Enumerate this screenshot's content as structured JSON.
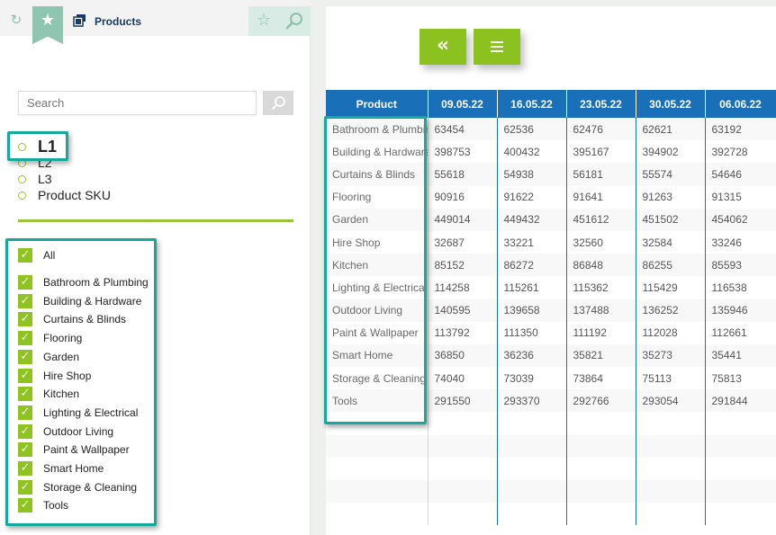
{
  "header": {
    "title": "Products",
    "refresh_icon": "refresh-icon",
    "bookmark_icon": "star-icon",
    "products_icon": "cube-icon",
    "star_icon": "star-outline-icon",
    "search_icon": "search-icon"
  },
  "search": {
    "placeholder": "Search"
  },
  "levels": [
    {
      "label": "L1",
      "active": true
    },
    {
      "label": "L2",
      "active": false
    },
    {
      "label": "L3",
      "active": false
    },
    {
      "label": "Product SKU",
      "active": false
    }
  ],
  "filters": {
    "all_label": "All",
    "items": [
      "Bathroom & Plumbing",
      "Building & Hardware",
      "Curtains & Blinds",
      "Flooring",
      "Garden",
      "Hire Shop",
      "Kitchen",
      "Lighting & Electrical",
      "Outdoor Living",
      "Paint & Wallpaper",
      "Smart Home",
      "Storage & Cleaning",
      "Tools"
    ]
  },
  "toolbar": {
    "collapse_label": "«",
    "menu_icon": "menu-icon"
  },
  "table": {
    "columns": [
      "Product",
      "09.05.22",
      "16.05.22",
      "23.05.22",
      "30.05.22",
      "06.06.22"
    ],
    "rows": [
      [
        "Bathroom & Plumbing",
        "63454",
        "62536",
        "62476",
        "62621",
        "63192"
      ],
      [
        "Building & Hardware",
        "398753",
        "400432",
        "395167",
        "394902",
        "392728"
      ],
      [
        "Curtains & Blinds",
        "55618",
        "54938",
        "56181",
        "55574",
        "54646"
      ],
      [
        "Flooring",
        "90916",
        "91622",
        "91641",
        "91263",
        "91315"
      ],
      [
        "Garden",
        "449014",
        "449432",
        "451612",
        "451502",
        "454062"
      ],
      [
        "Hire Shop",
        "32687",
        "33221",
        "32560",
        "32584",
        "33246"
      ],
      [
        "Kitchen",
        "85152",
        "86272",
        "86848",
        "86255",
        "85593"
      ],
      [
        "Lighting & Electrical",
        "114258",
        "115261",
        "115362",
        "115429",
        "116538"
      ],
      [
        "Outdoor Living",
        "140595",
        "139658",
        "137488",
        "136252",
        "135946"
      ],
      [
        "Paint & Wallpaper",
        "113792",
        "111350",
        "111192",
        "112028",
        "112661"
      ],
      [
        "Smart Home",
        "36850",
        "36236",
        "35821",
        "35273",
        "35441"
      ],
      [
        "Storage & Cleaning",
        "74040",
        "73039",
        "73864",
        "75113",
        "75813"
      ],
      [
        "Tools",
        "291550",
        "293370",
        "292766",
        "293054",
        "291844"
      ]
    ],
    "empty_rows": 5
  },
  "colors": {
    "accent_green": "#8cc21f",
    "header_blue": "#1a70b8",
    "highlight_teal": "#14a99a",
    "title_navy": "#1a3a63"
  }
}
